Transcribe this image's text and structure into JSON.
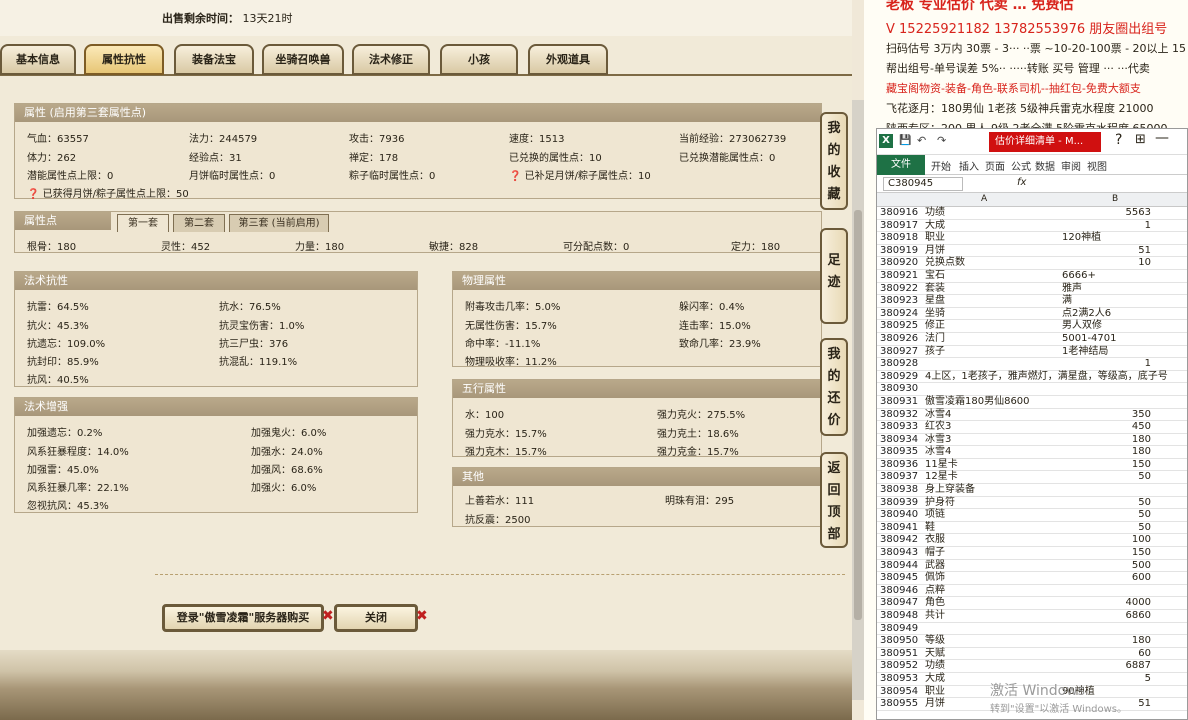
{
  "sale": {
    "label": "出售剩余时间：",
    "value": "13天21时"
  },
  "tabs": [
    "基本信息",
    "属性抗性",
    "装备法宝",
    "坐骑召唤兽",
    "法术修正",
    "小孩",
    "外观道具"
  ],
  "attr": {
    "title": "属性 (启用第三套属性点)",
    "rows": [
      [
        "气血：63557",
        "法力：244579",
        "攻击：7936",
        "速度：1513",
        "当前经验：273062739"
      ],
      [
        "体力：262",
        "经验点：31",
        "禅定：178",
        "已兑换的属性点：10",
        "已兑换潜能属性点：0"
      ],
      [
        "潜能属性点上限：0",
        "月饼临时属性点：0",
        "粽子临时属性点：0",
        "已补足月饼/粽子属性点：10",
        ""
      ]
    ],
    "note": "已获得月饼/粽子属性点上限：50"
  },
  "points": {
    "title": "属性点",
    "subtabs": [
      "第一套",
      "第二套",
      "第三套 (当前启用)"
    ],
    "values": [
      "根骨：180",
      "灵性：452",
      "力量：180",
      "敏捷：828",
      "可分配点数：0",
      "定力：180"
    ]
  },
  "resist": {
    "title": "法术抗性",
    "left": [
      "抗雷：64.5%",
      "抗火：45.3%",
      "抗遗忘：109.0%",
      "抗封印：85.9%",
      "抗风：40.5%"
    ],
    "right": [
      "抗水：76.5%",
      "抗灵宝伤害：1.0%",
      "抗三尸虫：376",
      "抗混乱：119.1%"
    ]
  },
  "enhance": {
    "title": "法术增强",
    "left": [
      "加强遗忘：0.2%",
      "风系狂暴程度：14.0%",
      "加强雷：45.0%",
      "风系狂暴几率：22.1%",
      "忽视抗风：45.3%"
    ],
    "right": [
      "加强鬼火：6.0%",
      "加强水：24.0%",
      "加强风：68.6%",
      "加强火：6.0%"
    ]
  },
  "physical": {
    "title": "物理属性",
    "left": [
      "附毒攻击几率：5.0%",
      "无属性伤害：15.7%",
      "命中率：-11.1%",
      "物理吸收率：11.2%"
    ],
    "right": [
      "躲闪率：0.4%",
      "连击率：15.0%",
      "致命几率：23.9%"
    ]
  },
  "five": {
    "title": "五行属性",
    "left": [
      "水：100",
      "强力克水：15.7%",
      "强力克木：15.7%"
    ],
    "right": [
      "强力克火：275.5%",
      "强力克土：18.6%",
      "强力克金：15.7%"
    ]
  },
  "other": {
    "title": "其他",
    "left": [
      "上善若水：111",
      "抗反震：2500"
    ],
    "right": [
      "明珠有泪：295"
    ]
  },
  "side_buttons": [
    "我的收藏",
    "足迹",
    "我的还价",
    "返回顶部"
  ],
  "buttons": {
    "buy": "登录\"傲雪凌霜\"服务器购买",
    "close": "关闭"
  },
  "ad": {
    "line0": "老板 专业估价 代卖 … 免费估",
    "line1": "V 15225921182   13782553976 朋友圈出组号",
    "line2": "扫码估号 3万内 30票 - 3··· ··票  ~10-20-100票 - 20以上 15",
    "line3": "帮出组号-单号误差 5%·· ·····转账 买号 管理 ··· ···代卖",
    "line4": "藏宝阁物资-装备-角色-联系司机--抽红包-免费大额支",
    "line5": "飞花逐月：180男仙 1老孩 5级神兵雷克水程度 21000",
    "line6": "陕西专区：200 男人 9级 2老全满 5阶雷克水程度 65000"
  },
  "excel": {
    "title": "估价详细清单 - M...",
    "ribbon": [
      "文件",
      "开始",
      "插入",
      "页面",
      "公式",
      "数据",
      "审阅",
      "视图"
    ],
    "namebox": "C380945",
    "fx": "fx",
    "cols": [
      "A",
      "B"
    ],
    "rows": [
      [
        "380916",
        "功绩",
        "",
        "5563"
      ],
      [
        "380917",
        "大成",
        "",
        "1"
      ],
      [
        "380918",
        "职业",
        "120神植",
        ""
      ],
      [
        "380919",
        "月饼",
        "",
        "51"
      ],
      [
        "380920",
        "兑换点数",
        "",
        "10"
      ],
      [
        "380921",
        "宝石",
        "6666+",
        ""
      ],
      [
        "380922",
        "套装",
        "雅声",
        ""
      ],
      [
        "380923",
        "星盘",
        "满",
        ""
      ],
      [
        "380924",
        "坐骑",
        "点2满2人6",
        ""
      ],
      [
        "380925",
        "修正",
        "男人双修",
        ""
      ],
      [
        "380926",
        "法门",
        "5001-4701",
        ""
      ],
      [
        "380927",
        "孩子",
        "1老神结局",
        ""
      ],
      [
        "380928",
        "",
        "",
        "1"
      ],
      [
        "380929",
        "4上区，1老孩子，雅声燃灯，满星盘，等级高，底子号",
        "",
        ""
      ],
      [
        "380930",
        "",
        "",
        ""
      ],
      [
        "380931",
        "傲雪凌霜180男仙8600",
        "",
        ""
      ],
      [
        "380932",
        "冰雪4",
        "",
        "350"
      ],
      [
        "380933",
        "红农3",
        "",
        "450"
      ],
      [
        "380934",
        "冰雪3",
        "",
        "180"
      ],
      [
        "380935",
        "冰雪4",
        "",
        "180"
      ],
      [
        "380936",
        "11星卡",
        "",
        "150"
      ],
      [
        "380937",
        "12星卡",
        "",
        "50"
      ],
      [
        "380938",
        "身上穿装备",
        "",
        ""
      ],
      [
        "380939",
        "护身符",
        "",
        "50"
      ],
      [
        "380940",
        "项链",
        "",
        "50"
      ],
      [
        "380941",
        "鞋",
        "",
        "50"
      ],
      [
        "380942",
        "衣服",
        "",
        "100"
      ],
      [
        "380943",
        "帽子",
        "",
        "150"
      ],
      [
        "380944",
        "武器",
        "",
        "500"
      ],
      [
        "380945",
        "佩饰",
        "",
        "600"
      ],
      [
        "380946",
        "点粹",
        "",
        ""
      ],
      [
        "380947",
        "角色",
        "",
        "4000"
      ],
      [
        "380948",
        "共计",
        "",
        "6860"
      ],
      [
        "380949",
        "",
        "",
        ""
      ],
      [
        "380950",
        "等级",
        "",
        "180"
      ],
      [
        "380951",
        "天赋",
        "",
        "60"
      ],
      [
        "380952",
        "功绩",
        "",
        "6887"
      ],
      [
        "380953",
        "大成",
        "",
        "5"
      ],
      [
        "380954",
        "职业",
        "90神植",
        ""
      ],
      [
        "380955",
        "月饼",
        "",
        "51"
      ]
    ]
  },
  "watermark": {
    "line1": "激活 Windows",
    "line2": "转到\"设置\"以激活 Windows。"
  }
}
